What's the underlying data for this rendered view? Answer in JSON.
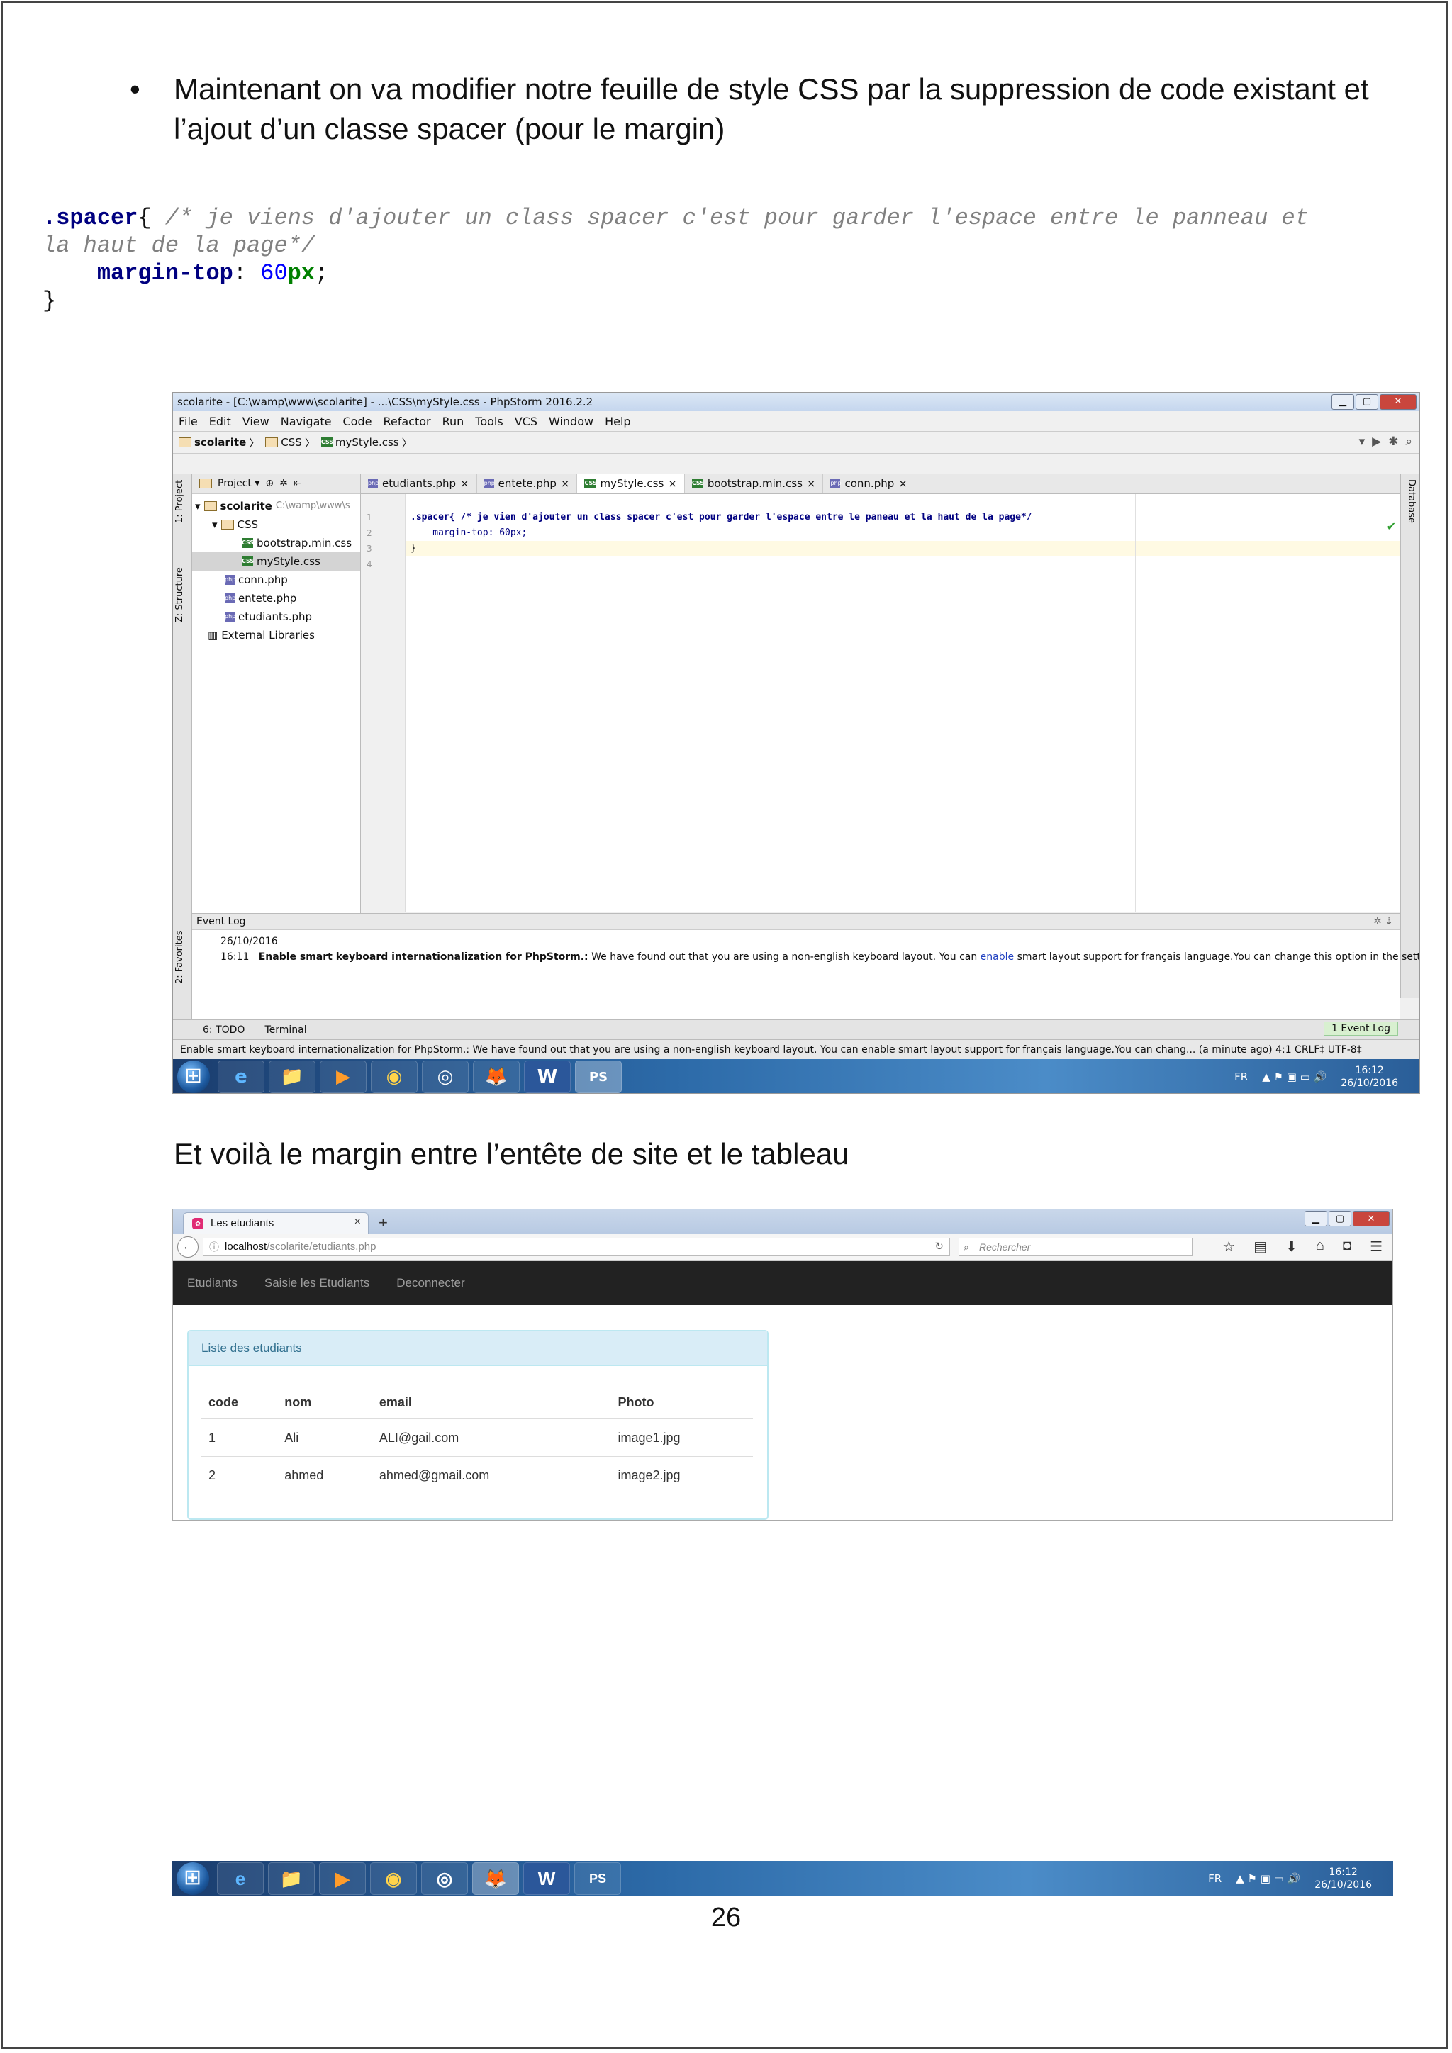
{
  "intro": {
    "bullet": "•",
    "text": "Maintenant on va modifier notre feuille de style CSS par la suppression de code existant et l’ajout d’un classe spacer (pour le margin)"
  },
  "code": {
    "selector": ".spacer",
    "brace_open": "{ ",
    "comment_1": "/* je viens d'ajouter un class spacer c'est pour garder l'espace entre le panneau et",
    "comment_2": "la haut de la page*/",
    "property": "margin-top",
    "colon": ": ",
    "value": "60",
    "unit": "px",
    "semicolon": ";",
    "brace_close": "}"
  },
  "ide": {
    "title": "scolarite - [C:\\wamp\\www\\scolarite] - ...\\CSS\\myStyle.css - PhpStorm 2016.2.2",
    "menu": [
      "File",
      "Edit",
      "View",
      "Navigate",
      "Code",
      "Refactor",
      "Run",
      "Tools",
      "VCS",
      "Window",
      "Help"
    ],
    "breadcrumb": [
      "scolarite",
      "CSS",
      "myStyle.css"
    ],
    "left_tools": [
      "1: Project",
      "Z: Structure",
      "2: Favorites"
    ],
    "right_tool": "Database",
    "project_header": "Project ▾",
    "tree": [
      {
        "label": "scolarite",
        "extra": "C:\\wamp\\www\\s",
        "type": "folder",
        "indent": 0
      },
      {
        "label": "CSS",
        "extra": "",
        "type": "folder",
        "indent": 1
      },
      {
        "label": "bootstrap.min.css",
        "extra": "",
        "type": "css",
        "indent": 2
      },
      {
        "label": "myStyle.css",
        "extra": "",
        "type": "css",
        "indent": 2,
        "selected": true
      },
      {
        "label": "conn.php",
        "extra": "",
        "type": "php",
        "indent": 1
      },
      {
        "label": "entete.php",
        "extra": "",
        "type": "php",
        "indent": 1
      },
      {
        "label": "etudiants.php",
        "extra": "",
        "type": "php",
        "indent": 1
      },
      {
        "label": "External Libraries",
        "extra": "",
        "type": "lib",
        "indent": 0
      }
    ],
    "tabs": [
      {
        "label": "etudiants.php",
        "type": "php"
      },
      {
        "label": "entete.php",
        "type": "php"
      },
      {
        "label": "myStyle.css",
        "type": "css",
        "active": true
      },
      {
        "label": "bootstrap.min.css",
        "type": "css"
      },
      {
        "label": "conn.php",
        "type": "php"
      }
    ],
    "gutter": [
      "1",
      "2",
      "3",
      "4"
    ],
    "code_lines": [
      ".spacer{ /* je vien d'ajouter un class spacer c'est pour garder l'espace entre le paneau et la haut de la page*/",
      "    margin-top: 60px;",
      "}",
      ""
    ],
    "event_log": {
      "title": "Event Log",
      "date": "26/10/2016",
      "time": "16:11",
      "bold": "Enable smart keyboard internationalization for PhpStorm.:",
      "text_before": " We have found out that you are using a non-english keyboard layout. You can ",
      "link": "enable",
      "text_after": " smart layout support for français language.You can change this option in the settings o"
    },
    "bottom_tabs": [
      "6: TODO",
      "Terminal"
    ],
    "event_log_tab": "1  Event Log",
    "status": "Enable smart keyboard internationalization for PhpStorm.: We have found out that you are using a non-english keyboard layout. You can enable smart layout support for français language.You can chang... (a minute ago)   4:1   CRLF‡   UTF-8‡"
  },
  "taskbar": {
    "apps": [
      "e",
      "📁",
      "▶",
      "◉",
      "◎",
      "🦊",
      "W",
      "PS"
    ],
    "lang": "FR",
    "tray_icons": "▲  ⚑  ▣  ▭  🔊",
    "time": "16:12",
    "date": "26/10/2016"
  },
  "caption": "Et voilà le margin entre l’entête de site et le tableau",
  "browser": {
    "tab_title": "Les etudiants",
    "tab_close": "×",
    "new_tab": "+",
    "url_host": "localhost",
    "url_path": "/scolarite/etudiants.php",
    "search_placeholder": "Rechercher",
    "nav_items": [
      "Etudiants",
      "Saisie les Etudiants",
      "Deconnecter"
    ],
    "panel_title": "Liste des etudiants",
    "columns": [
      "code",
      "nom",
      "email",
      "Photo"
    ],
    "rows": [
      [
        "1",
        "Ali",
        "ALI@gail.com",
        "image1.jpg"
      ],
      [
        "2",
        "ahmed",
        "ahmed@gmail.com",
        "image2.jpg"
      ]
    ]
  },
  "page_number": "26"
}
